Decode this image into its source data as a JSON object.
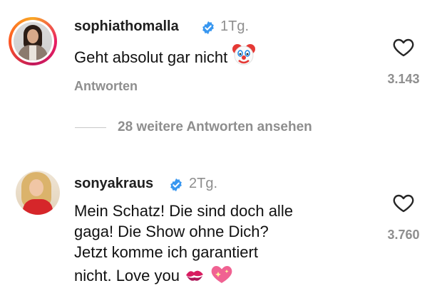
{
  "comments": [
    {
      "username": "sophiathomalla",
      "time": "1Tg.",
      "text": "Geht absolut gar nicht",
      "emoji": "clown-face-emoji",
      "reply_label": "Antworten",
      "likes": "3.143"
    },
    {
      "username": "sonyakraus",
      "time": "2Tg.",
      "lines": [
        "Mein Schatz! Die sind doch alle",
        "gaga! Die Show ohne Dich?",
        "Jetzt komme ich garantiert",
        "nicht. Love you"
      ],
      "emojis": [
        "kiss-mark-emoji",
        "sparkling-heart-emoji"
      ],
      "likes": "3.760"
    }
  ],
  "view_more": "28 weitere Antworten ansehen",
  "colors": {
    "verified": "#3897f0",
    "muted": "#8e8e8e",
    "ring_gradient": [
      "#f9a825",
      "#e91e63",
      "#c2185b",
      "#ff5722"
    ]
  }
}
